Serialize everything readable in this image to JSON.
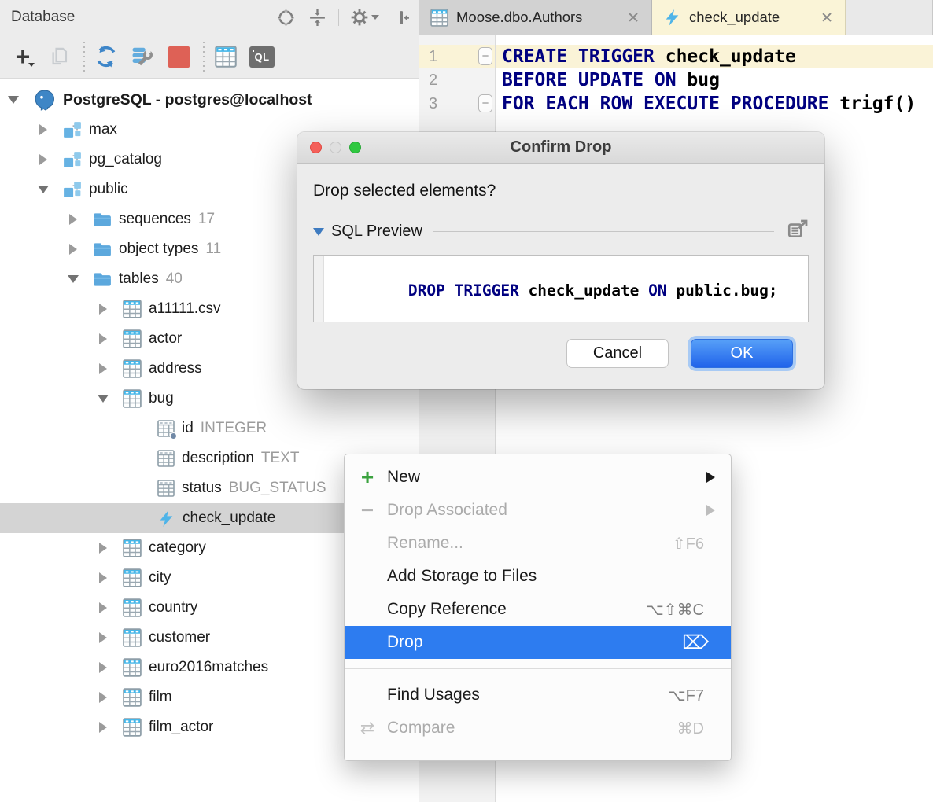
{
  "panel": {
    "title": "Database",
    "toolbar": {
      "ql_label": "QL"
    }
  },
  "tree": {
    "items": [
      {
        "label": "PostgreSQL - postgres@localhost"
      },
      {
        "label": "max"
      },
      {
        "label": "pg_catalog"
      },
      {
        "label": "public"
      },
      {
        "label": "sequences",
        "meta": "17"
      },
      {
        "label": "object types",
        "meta": "11"
      },
      {
        "label": "tables",
        "meta": "40"
      },
      {
        "label": "a11111.csv"
      },
      {
        "label": "actor"
      },
      {
        "label": "address"
      },
      {
        "label": "bug"
      },
      {
        "label": "id",
        "meta": "INTEGER"
      },
      {
        "label": "description",
        "meta": "TEXT"
      },
      {
        "label": "status",
        "meta": "BUG_STATUS"
      },
      {
        "label": "check_update"
      },
      {
        "label": "category"
      },
      {
        "label": "city"
      },
      {
        "label": "country"
      },
      {
        "label": "customer"
      },
      {
        "label": "euro2016matches"
      },
      {
        "label": "film"
      },
      {
        "label": "film_actor"
      }
    ]
  },
  "tabs": [
    {
      "label": "Moose.dbo.Authors"
    },
    {
      "label": "check_update"
    }
  ],
  "editor": {
    "line_numbers": [
      "1",
      "2",
      "3"
    ],
    "lines": [
      {
        "kw1": "CREATE TRIGGER ",
        "id1": "check_update"
      },
      {
        "kw1": "BEFORE UPDATE ON ",
        "id1": "bug"
      },
      {
        "kw1": "FOR EACH ROW EXECUTE PROCEDURE ",
        "id1": "trigf()"
      }
    ]
  },
  "dialog": {
    "title": "Confirm Drop",
    "message": "Drop selected elements?",
    "section_label": "SQL Preview",
    "sql": {
      "kw1": "DROP TRIGGER ",
      "id1": "check_update ",
      "kw2": "ON ",
      "id2": "public.bug;"
    },
    "cancel_label": "Cancel",
    "ok_label": "OK"
  },
  "menu": {
    "items": [
      {
        "label": "New"
      },
      {
        "label": "Drop Associated"
      },
      {
        "label": "Rename...",
        "shortcut": "⇧F6"
      },
      {
        "label": "Add Storage to Files"
      },
      {
        "label": "Copy Reference",
        "shortcut": "⌥⇧⌘C"
      },
      {
        "label": "Drop",
        "shortcut": "⌦"
      },
      {
        "label": "Find Usages",
        "shortcut": "⌥F7"
      },
      {
        "label": "Compare",
        "shortcut": "⌘D"
      }
    ]
  },
  "colors": {
    "menu_selection_blue": "#2D7CF0",
    "accent_blue": "#4FB4E8",
    "keyword_navy": "#000080",
    "caret_line_yellow": "#FAF3D7",
    "tree_selection_gray": "#D4D4D4",
    "stop_red": "#DE6156"
  }
}
